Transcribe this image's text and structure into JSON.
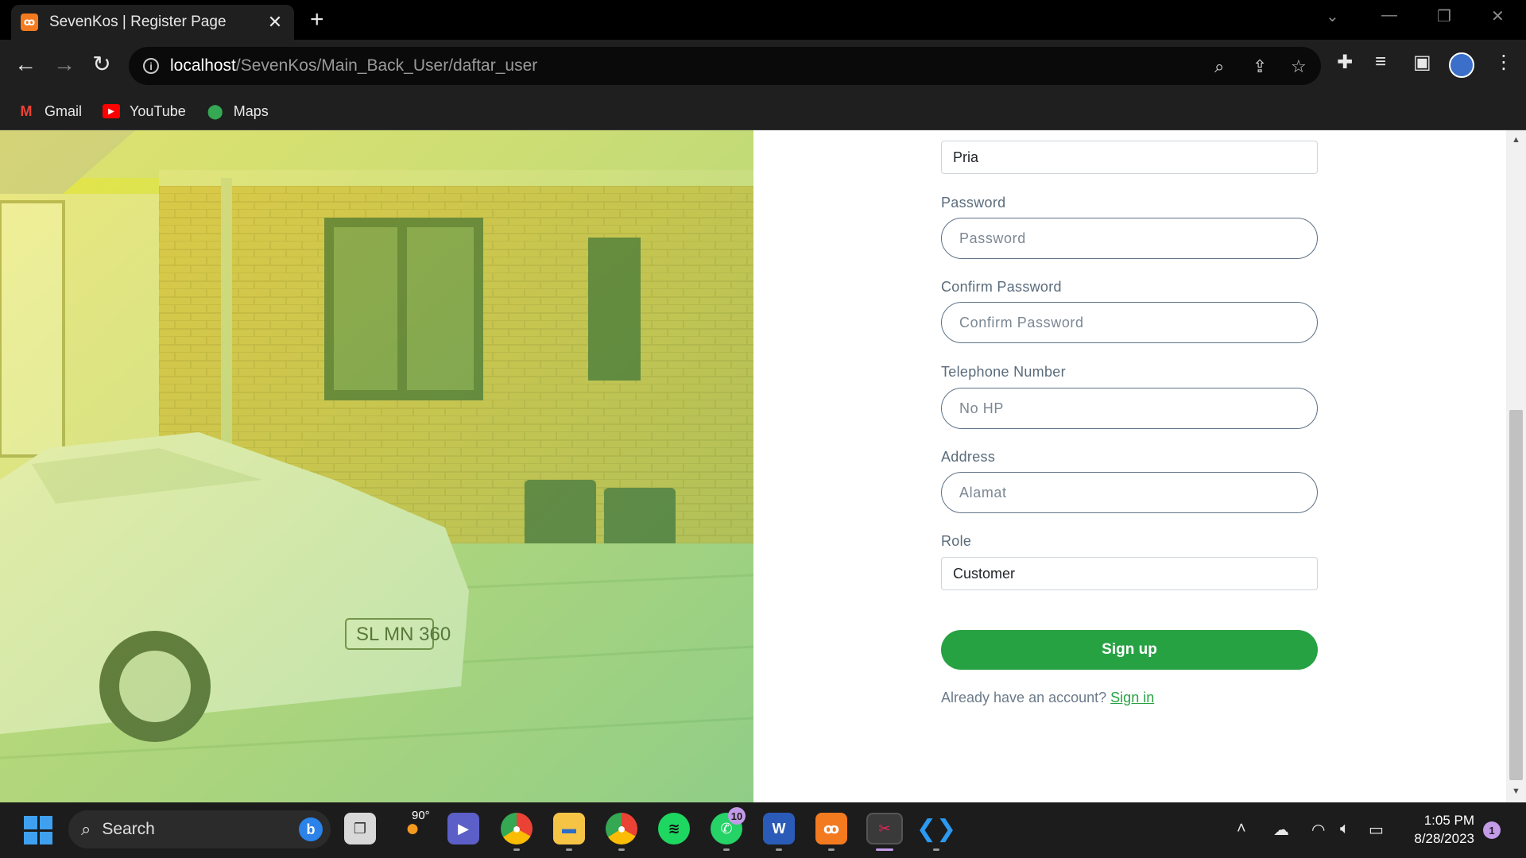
{
  "browser": {
    "tab_title": "SevenKos | Register Page",
    "tab_favicon": "xampp-icon",
    "url_host": "localhost",
    "url_path": "/SevenKos/Main_Back_User/daftar_user",
    "bookmarks": [
      {
        "label": "Gmail",
        "icon": "gmail-icon"
      },
      {
        "label": "YouTube",
        "icon": "youtube-icon"
      },
      {
        "label": "Maps",
        "icon": "maps-icon"
      }
    ]
  },
  "form": {
    "gender_value": "Pria",
    "password": {
      "label": "Password",
      "placeholder": "Password"
    },
    "confirm_password": {
      "label": "Confirm Password",
      "placeholder": "Confirm Password"
    },
    "telephone": {
      "label": "Telephone Number",
      "placeholder": "No HP"
    },
    "address": {
      "label": "Address",
      "placeholder": "Alamat"
    },
    "role": {
      "label": "Role",
      "value": "Customer"
    },
    "signup_label": "Sign up",
    "signin_prompt": "Already have an account?",
    "signin_link": "Sign in"
  },
  "colors": {
    "accent_green": "#27a243",
    "input_border": "#5f7286"
  },
  "taskbar": {
    "search_label": "Search",
    "weather_temp": "90°",
    "whatsapp_badge": "10",
    "notification_badge": "1",
    "time": "1:05 PM",
    "date": "8/28/2023",
    "apps": [
      "file-explorer-icon",
      "weather-icon",
      "teams-icon",
      "chrome-icon",
      "folder-icon",
      "chrome-icon",
      "spotify-icon",
      "whatsapp-icon",
      "word-icon",
      "xampp-icon",
      "snipping-tool-icon",
      "vscode-icon"
    ]
  }
}
